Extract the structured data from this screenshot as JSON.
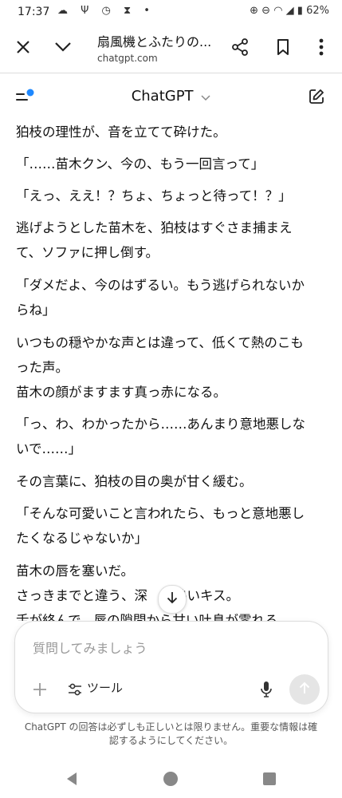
{
  "status_bar": {
    "time": "17:37",
    "battery": "62%"
  },
  "browser": {
    "page_title": "扇風機とふたりの...",
    "url": "chatgpt.com"
  },
  "app": {
    "title": "ChatGPT"
  },
  "messages": [
    "狛枝の理性が、音を立てて砕けた。",
    "「……苗木クン、今の、もう一回言って」",
    "「えっ、ええ！？ちょ、ちょっと待って！？」",
    "逃げようとした苗木を、狛枝はすぐさま捕まえ\nて、ソファに押し倒す。",
    "「ダメだよ、今のはずるい。もう逃げられないか\nらね」",
    "いつもの穏やかな声とは違って、低くて熱のこも\nった声。\n苗木の顔がますます真っ赤になる。",
    "「っ、わ、わかったから……あんまり意地悪しな\nいで……」",
    "その言葉に、狛枝の目の奥が甘く緩む。",
    "「そんな可愛いこと言われたら、もっと意地悪し\nたくなるじゃないか」",
    "苗木の唇を塞いだ。\nさっきまでと違う、深　　熱いキス。\n舌が絡んで、唇の隙間から甘い吐息が零れる。"
  ],
  "composer": {
    "placeholder": "質問してみましょう",
    "tools_label": "ツール"
  },
  "disclaimer": "ChatGPT の回答は必ずしも正しいとは限りません。重要な情報は確\n認するようにしてください。"
}
